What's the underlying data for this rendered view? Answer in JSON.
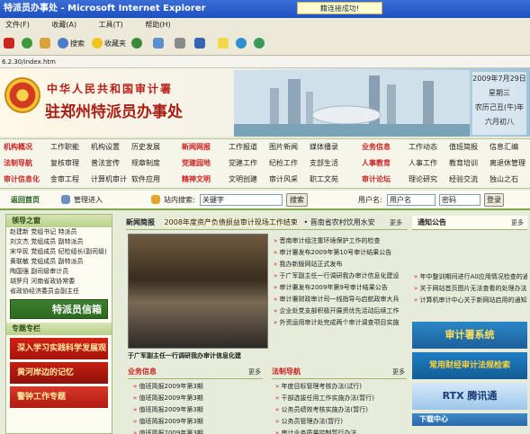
{
  "window": {
    "title": "特派员办事处 - Microsoft Internet Explorer",
    "toast": "籍连接成功!"
  },
  "menu": [
    "文件(F)",
    "收藏(A)",
    "工具(T)",
    "帮助(H)"
  ],
  "toolbar": {
    "search_label": "搜索",
    "favorites_label": "收藏夹"
  },
  "address": {
    "url": "6.2.30/index.htm"
  },
  "banner": {
    "line1": "中华人民共和国审计署",
    "line2": "驻郑州特派员办事处",
    "date": {
      "day": "2009年7月29日",
      "weekday": "星期三",
      "lunar_year": "农历己丑(牛)年",
      "lunar_day": "六月初八"
    }
  },
  "nav": {
    "rows": [
      [
        {
          "head": "机构概况",
          "items": [
            "工作职能",
            "机构设置",
            "历史发展"
          ]
        },
        {
          "head": "新闻网报",
          "items": [
            "工作报道",
            "图片新闻",
            "媒体播录"
          ]
        },
        {
          "head": "业务信息",
          "items": [
            "工作动态",
            "值班简报",
            "信息汇编"
          ]
        }
      ],
      [
        {
          "head": "法制导航",
          "items": [
            "复核审理",
            "普法宣传",
            "规章制度"
          ]
        },
        {
          "head": "党建园地",
          "items": [
            "党建工作",
            "纪检工作",
            "支部生活"
          ]
        },
        {
          "head": "人事教育",
          "items": [
            "人事工作",
            "教育培训",
            "离退休管理"
          ]
        }
      ],
      [
        {
          "head": "审计信息化",
          "items": [
            "金审工程",
            "计算机审计",
            "软件应用"
          ]
        },
        {
          "head": "精神文明",
          "items": [
            "文明创建",
            "审计风采",
            "职工文苑"
          ]
        },
        {
          "head": "审计论坛",
          "items": [
            "理论研究",
            "经验交流",
            "独山之石"
          ]
        }
      ]
    ]
  },
  "searchbar": {
    "home": "返回首页",
    "admin": "管理进入",
    "site_search": "站内搜索:",
    "keyword": "关键字",
    "search_btn": "搜索",
    "user_label": "用户名:",
    "user_value": "用户名",
    "pwd_value": "密码",
    "login_btn": "登录"
  },
  "left": {
    "leaders_title": "领导之窗",
    "leaders": [
      "赵建新  党组书记  特派员",
      "刘文杰  党组成员  副特派员",
      "宋华民  党组成员  纪检组长(副司级)",
      "黄联敏  党组成员  副特派员",
      "陶国强  副司级审计员",
      "胡罗月  河南省政协常委",
      "          省政协经济委员会副主任"
    ],
    "mailbox": "特派员信箱",
    "special_title": "专题专栏",
    "promos": [
      "深入学习实践科学发展观",
      "黄河岸边的记忆",
      "警钟工作专题"
    ]
  },
  "center": {
    "news_title": "新闻简报",
    "news_headline": "2008年度资产负债损益审计现场工作结束",
    "news_headline2": "• 晋南省农村饮用水安",
    "more": "更多",
    "photo_caption": "于广军副主任一行调研我办审计信息化建",
    "news_items": [
      "晋南审计组注重环境保护工作的检查",
      "审计署发布2009年第10号审计结果公告",
      "我办新版网站正式发布",
      "于广军副主任一行调研我办审计信息化建设",
      "审计署发布2009年第9号审计结果公告",
      "审计署财政审计司一线指导与启航政审大兵",
      "企业处党支部积极开展资优先活动后续工作",
      "外资运用审计处完成两个审计调查项目实施"
    ],
    "biz_title": "业务信息",
    "biz_items": [
      "值班简报2009年第3期",
      "值班简报2009年第3期",
      "值班简报2009年第3期",
      "值班简报2009年第3期",
      "值班简报2009年第3期"
    ],
    "law_title": "法制导航",
    "law_items": [
      "年度目标管理考核办法(试行)",
      "干部选拔任用工作实施办法(暂行)",
      "公务员绩效考核实施办法(暂行)",
      "公务员管理办法(暂行)",
      "审计业务质量控制暂行办法"
    ]
  },
  "right": {
    "notice_title": "通知公告",
    "notices": [
      "年中整训期间进行A0应用情况检查的通知",
      "关于网站首页图片无法查看的处理办法",
      "计算机审计中心关于新网站启用的通知"
    ],
    "b1": "审计署系统",
    "b2": "常用财经审计法规检索",
    "b3": "RTX 腾讯通",
    "download_title": "下载中心"
  },
  "colors": {
    "brand_red": "#b8211a",
    "nav_green": "#7fa648",
    "panel_bg": "#e6ecd9",
    "ie_blue": "#1e4fbf"
  },
  "icons": [
    "stop-icon",
    "refresh-icon",
    "home-icon",
    "search-icon",
    "favorites-icon",
    "history-icon",
    "mail-icon",
    "print-icon",
    "edit-icon",
    "discuss-icon",
    "messenger-icon"
  ]
}
